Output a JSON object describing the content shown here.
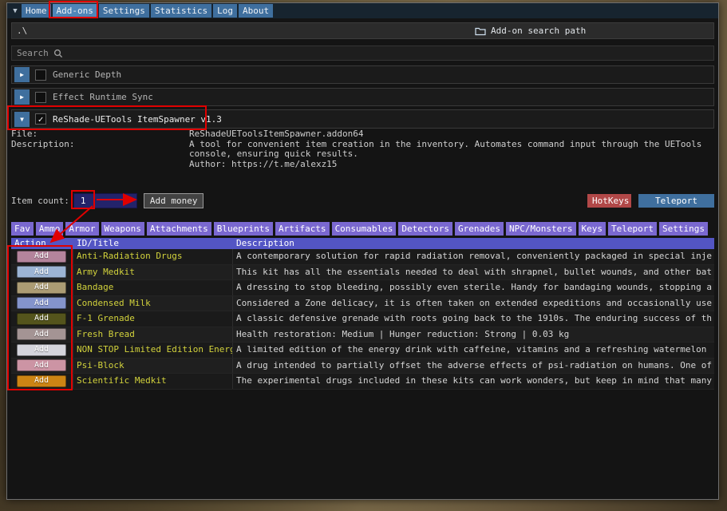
{
  "window": {
    "menu": {
      "items": [
        {
          "label": "Home",
          "active": false
        },
        {
          "label": "Add-ons",
          "active": true
        },
        {
          "label": "Settings",
          "active": false
        },
        {
          "label": "Statistics",
          "active": false
        },
        {
          "label": "Log",
          "active": false
        },
        {
          "label": "About",
          "active": false
        }
      ]
    },
    "path_bar": {
      "path": ".\\",
      "button_label": "Add-on search path"
    },
    "search": {
      "label": "Search"
    },
    "collapsed_addons": [
      {
        "label": "Generic Depth",
        "checked": false
      },
      {
        "label": "Effect Runtime Sync",
        "checked": false
      }
    ],
    "addon": {
      "title": "ReShade-UETools ItemSpawner v1.3",
      "checked": true,
      "file_label": "File:",
      "file_value": "ReShadeUEToolsItemSpawner.addon64",
      "description_label": "Description:",
      "description_lines": [
        "A tool for convenient item creation in the inventory. Automates command input through the UETools",
        "console, ensuring quick results.",
        "Author: https://t.me/alexz15"
      ]
    },
    "spawner": {
      "item_count_label": "Item count:",
      "item_count_value": "1",
      "add_money_button": "Add money",
      "hotkeys_button": "HotKeys",
      "teleport_button": "Teleport",
      "tabs": [
        "Fav",
        "Ammo",
        "Armor",
        "Weapons",
        "Attachments",
        "Blueprints",
        "Artifacts",
        "Consumables",
        "Detectors",
        "Grenades",
        "NPC/Monsters",
        "Keys",
        "Teleport",
        "Settings"
      ],
      "table": {
        "headers": [
          "Action",
          "ID/Title",
          "Description"
        ],
        "add_label": "Add",
        "rows": [
          {
            "title": "Anti-Radiation Drugs",
            "description": "A contemporary solution for rapid radiation removal, conveniently packaged in special inje",
            "button_color": "#b4849c"
          },
          {
            "title": "Army Medkit",
            "description": "This kit has all the essentials needed to deal with shrapnel, bullet wounds, and other bat",
            "button_color": "#9cb4d4"
          },
          {
            "title": "Bandage",
            "description": "A dressing to stop bleeding, possibly even sterile. Handy for bandaging wounds, stopping a",
            "button_color": "#ac9c74"
          },
          {
            "title": "Condensed Milk",
            "description": "Considered a Zone delicacy, it is often taken on extended expeditions and occasionally use",
            "button_color": "#8494cc"
          },
          {
            "title": "F-1 Grenade",
            "description": "A classic defensive grenade with roots going back to the 1910s. The enduring success of th",
            "button_color": "#54541c"
          },
          {
            "title": "Fresh Bread",
            "description": "Health restoration: Medium | Hunger reduction: Strong | 0.03 kg",
            "button_color": "#a49494"
          },
          {
            "title": "NON STOP Limited Edition Energ",
            "description": "A limited edition of the energy drink with caffeine, vitamins and a refreshing watermelon",
            "button_color": "#d4d4dc"
          },
          {
            "title": "Psi-Block",
            "description": "A drug intended to partially offset the adverse effects of psi-radiation on humans. One of",
            "button_color": "#cc94a4"
          },
          {
            "title": "Scientific Medkit",
            "description": "The experimental drugs included in these kits can work wonders, but keep in mind that many",
            "button_color": "#cc8414"
          }
        ]
      }
    }
  },
  "icons": {
    "menu_collapse": "▼",
    "expand": "▶",
    "collapse": "▼",
    "check": "✓"
  },
  "colors": {
    "accent_blue": "#3f6f9e",
    "menu_active_blue": "#4f86b8",
    "tab_purple": "#7a68d0",
    "header_indigo": "#5355c4",
    "hotkeys_red": "#b14848",
    "item_yellow": "#d2d23c",
    "input_navy": "#23236a",
    "annotation_red": "#e00000"
  }
}
